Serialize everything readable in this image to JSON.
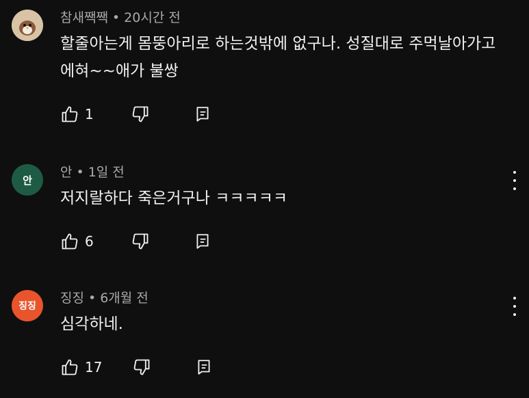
{
  "comments": [
    {
      "author": "참새짹짹",
      "time": "20시간 전",
      "text": "할줄아는게 몸뚱아리로 하는것밖에 없구나. 성질대로 주먹날아가고 에혀~~애가 불쌍",
      "likes": "1",
      "avatar_text": "",
      "avatar_color": "#d8c2a8"
    },
    {
      "author": "안",
      "time": "1일 전",
      "text": "저지랄하다 죽은거구나 ㅋㅋㅋㅋㅋ",
      "likes": "6",
      "avatar_text": "안",
      "avatar_color": "#1e5b45"
    },
    {
      "author": "징징",
      "time": "6개월 전",
      "text": "심각하네.",
      "likes": "17",
      "avatar_text": "징징",
      "avatar_color": "#e8542c"
    }
  ],
  "separator": "•",
  "icons": {
    "like": "thumbs-up-icon",
    "dislike": "thumbs-down-icon",
    "reply": "reply-icon",
    "more": "more-vert-icon"
  }
}
